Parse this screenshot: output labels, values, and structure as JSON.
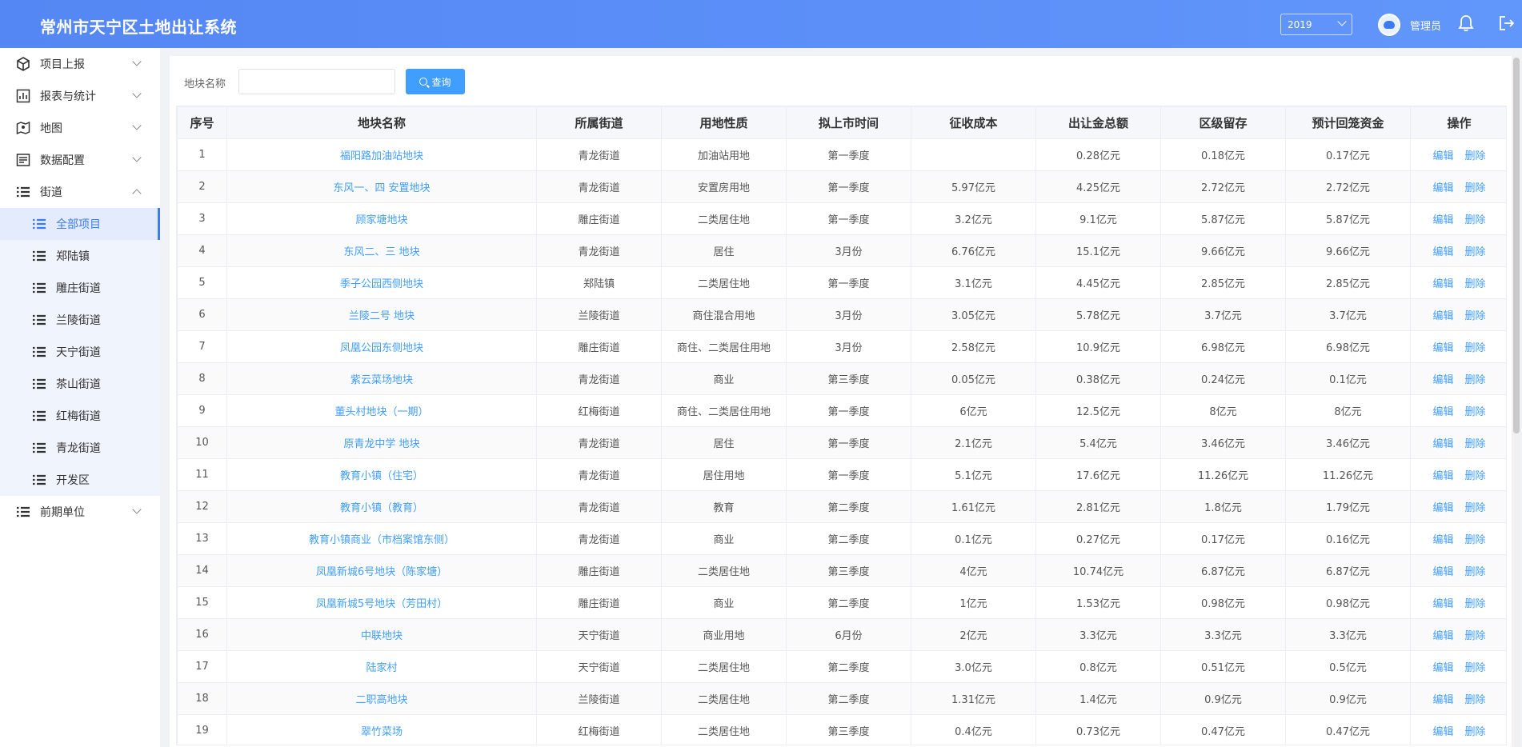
{
  "header": {
    "title": "常州市天宁区土地出让系统",
    "year": "2019",
    "user": "管理员"
  },
  "sidebar": {
    "items": [
      {
        "label": "项目上报",
        "icon": "cube-icon"
      },
      {
        "label": "报表与统计",
        "icon": "chart-icon"
      },
      {
        "label": "地图",
        "icon": "map-icon"
      },
      {
        "label": "数据配置",
        "icon": "database-icon"
      },
      {
        "label": "街道",
        "icon": "list-icon"
      },
      {
        "label": "前期单位",
        "icon": "list-icon"
      }
    ],
    "sub_items": [
      "全部项目",
      "郑陆镇",
      "雕庄街道",
      "兰陵街道",
      "天宁街道",
      "茶山街道",
      "红梅街道",
      "青龙街道",
      "开发区"
    ]
  },
  "search": {
    "label": "地块名称",
    "value": "",
    "button": "查询"
  },
  "table": {
    "headers": [
      "序号",
      "地块名称",
      "所属街道",
      "用地性质",
      "拟上市时间",
      "征收成本",
      "出让金总额",
      "区级留存",
      "预计回笼资金",
      "操作"
    ],
    "ops": {
      "edit": "编辑",
      "delete": "删除"
    },
    "rows": [
      [
        "1",
        "福阳路加油站地块",
        "青龙街道",
        "加油站用地",
        "第一季度",
        "",
        "0.28亿元",
        "0.18亿元",
        "0.17亿元"
      ],
      [
        "2",
        "东风一、四 安置地块",
        "青龙街道",
        "安置房用地",
        "第一季度",
        "5.97亿元",
        "4.25亿元",
        "2.72亿元",
        "2.72亿元"
      ],
      [
        "3",
        "顾家塘地块",
        "雕庄街道",
        "二类居住地",
        "第一季度",
        "3.2亿元",
        "9.1亿元",
        "5.87亿元",
        "5.87亿元"
      ],
      [
        "4",
        "东风二、三 地块",
        "青龙街道",
        "居住",
        "3月份",
        "6.76亿元",
        "15.1亿元",
        "9.66亿元",
        "9.66亿元"
      ],
      [
        "5",
        "季子公园西侧地块",
        "郑陆镇",
        "二类居住地",
        "第一季度",
        "3.1亿元",
        "4.45亿元",
        "2.85亿元",
        "2.85亿元"
      ],
      [
        "6",
        "兰陵二号 地块",
        "兰陵街道",
        "商住混合用地",
        "3月份",
        "3.05亿元",
        "5.78亿元",
        "3.7亿元",
        "3.7亿元"
      ],
      [
        "7",
        "凤凰公园东侧地块",
        "雕庄街道",
        "商住、二类居住用地",
        "3月份",
        "2.58亿元",
        "10.9亿元",
        "6.98亿元",
        "6.98亿元"
      ],
      [
        "8",
        "紫云菜场地块",
        "青龙街道",
        "商业",
        "第三季度",
        "0.05亿元",
        "0.38亿元",
        "0.24亿元",
        "0.1亿元"
      ],
      [
        "9",
        "董头村地块（一期）",
        "红梅街道",
        "商住、二类居住用地",
        "第一季度",
        "6亿元",
        "12.5亿元",
        "8亿元",
        "8亿元"
      ],
      [
        "10",
        "原青龙中学 地块",
        "青龙街道",
        "居住",
        "第一季度",
        "2.1亿元",
        "5.4亿元",
        "3.46亿元",
        "3.46亿元"
      ],
      [
        "11",
        "教育小镇（住宅）",
        "青龙街道",
        "居住用地",
        "第一季度",
        "5.1亿元",
        "17.6亿元",
        "11.26亿元",
        "11.26亿元"
      ],
      [
        "12",
        "教育小镇（教育）",
        "青龙街道",
        "教育",
        "第二季度",
        "1.61亿元",
        "2.81亿元",
        "1.8亿元",
        "1.79亿元"
      ],
      [
        "13",
        "教育小镇商业（市档案馆东侧）",
        "青龙街道",
        "商业",
        "第二季度",
        "0.1亿元",
        "0.27亿元",
        "0.17亿元",
        "0.16亿元"
      ],
      [
        "14",
        "凤凰新城6号地块（陈家塘）",
        "雕庄街道",
        "二类居住地",
        "第三季度",
        "4亿元",
        "10.74亿元",
        "6.87亿元",
        "6.87亿元"
      ],
      [
        "15",
        "凤凰新城5号地块（芳田村）",
        "雕庄街道",
        "商业",
        "第二季度",
        "1亿元",
        "1.53亿元",
        "0.98亿元",
        "0.98亿元"
      ],
      [
        "16",
        "中联地块",
        "天宁街道",
        "商业用地",
        "6月份",
        "2亿元",
        "3.3亿元",
        "3.3亿元",
        "3.3亿元"
      ],
      [
        "17",
        "陆家村",
        "天宁街道",
        "二类居住地",
        "第二季度",
        "3.0亿元",
        "0.8亿元",
        "0.51亿元",
        "0.5亿元"
      ],
      [
        "18",
        "二职高地块",
        "兰陵街道",
        "二类居住地",
        "第二季度",
        "1.31亿元",
        "1.4亿元",
        "0.9亿元",
        "0.9亿元"
      ],
      [
        "19",
        "翠竹菜场",
        "红梅街道",
        "二类居住地",
        "第三季度",
        "0.4亿元",
        "0.73亿元",
        "0.47亿元",
        "0.47亿元"
      ]
    ]
  }
}
